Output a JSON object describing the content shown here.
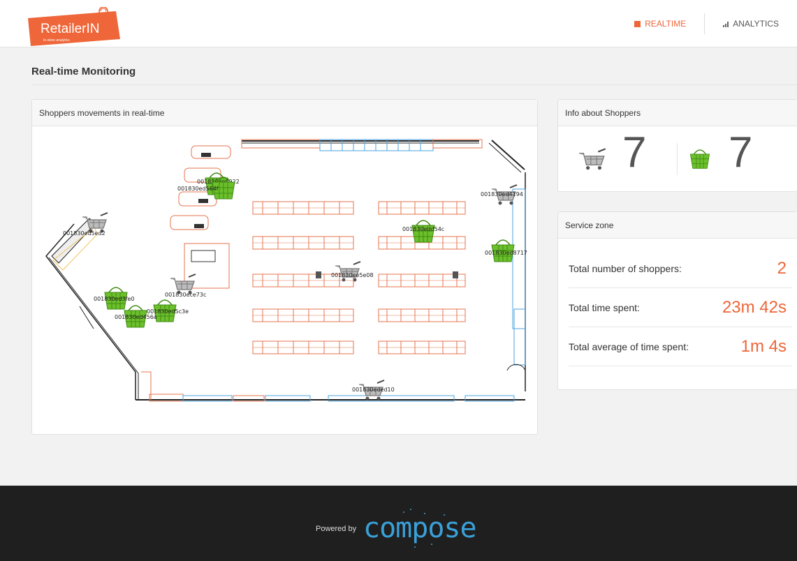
{
  "brand": {
    "name": "RetailerIN",
    "tagline": "In-store analytics",
    "color": "#ee6639"
  },
  "nav": {
    "realtime_label": "REALTIME",
    "analytics_label": "ANALYTICS",
    "active": "realtime"
  },
  "page": {
    "title": "Real-time Monitoring"
  },
  "map_panel": {
    "title": "Shoppers movements in real-time",
    "shoppers": [
      {
        "id": "001830ed5ed2",
        "kind": "cart"
      },
      {
        "id": "001830ee0922",
        "kind": "basket"
      },
      {
        "id": "001830ed564f",
        "kind": "basket"
      },
      {
        "id": "001830ed4194",
        "kind": "cart"
      },
      {
        "id": "001830edd54c",
        "kind": "basket"
      },
      {
        "id": "001830ed8717",
        "kind": "basket"
      },
      {
        "id": "001830ee5e08",
        "kind": "cart"
      },
      {
        "id": "001830ece73c",
        "kind": "cart"
      },
      {
        "id": "001830ed3fe0",
        "kind": "basket"
      },
      {
        "id": "001830ed5c3e",
        "kind": "basket"
      },
      {
        "id": "001830ed456a",
        "kind": "basket"
      },
      {
        "id": "001830eded10",
        "kind": "cart"
      }
    ]
  },
  "info_panel": {
    "title": "Info about Shoppers",
    "cart_count": "7",
    "basket_count": "7"
  },
  "service_zone": {
    "title": "Service zone",
    "rows": [
      {
        "label": "Total number of shoppers:",
        "value": "2"
      },
      {
        "label": "Total time spent:",
        "value": "23m 42s"
      },
      {
        "label": "Total average of time spent:",
        "value": "1m 4s"
      }
    ]
  },
  "footer": {
    "powered_by": "Powered by",
    "partner": "compose"
  }
}
